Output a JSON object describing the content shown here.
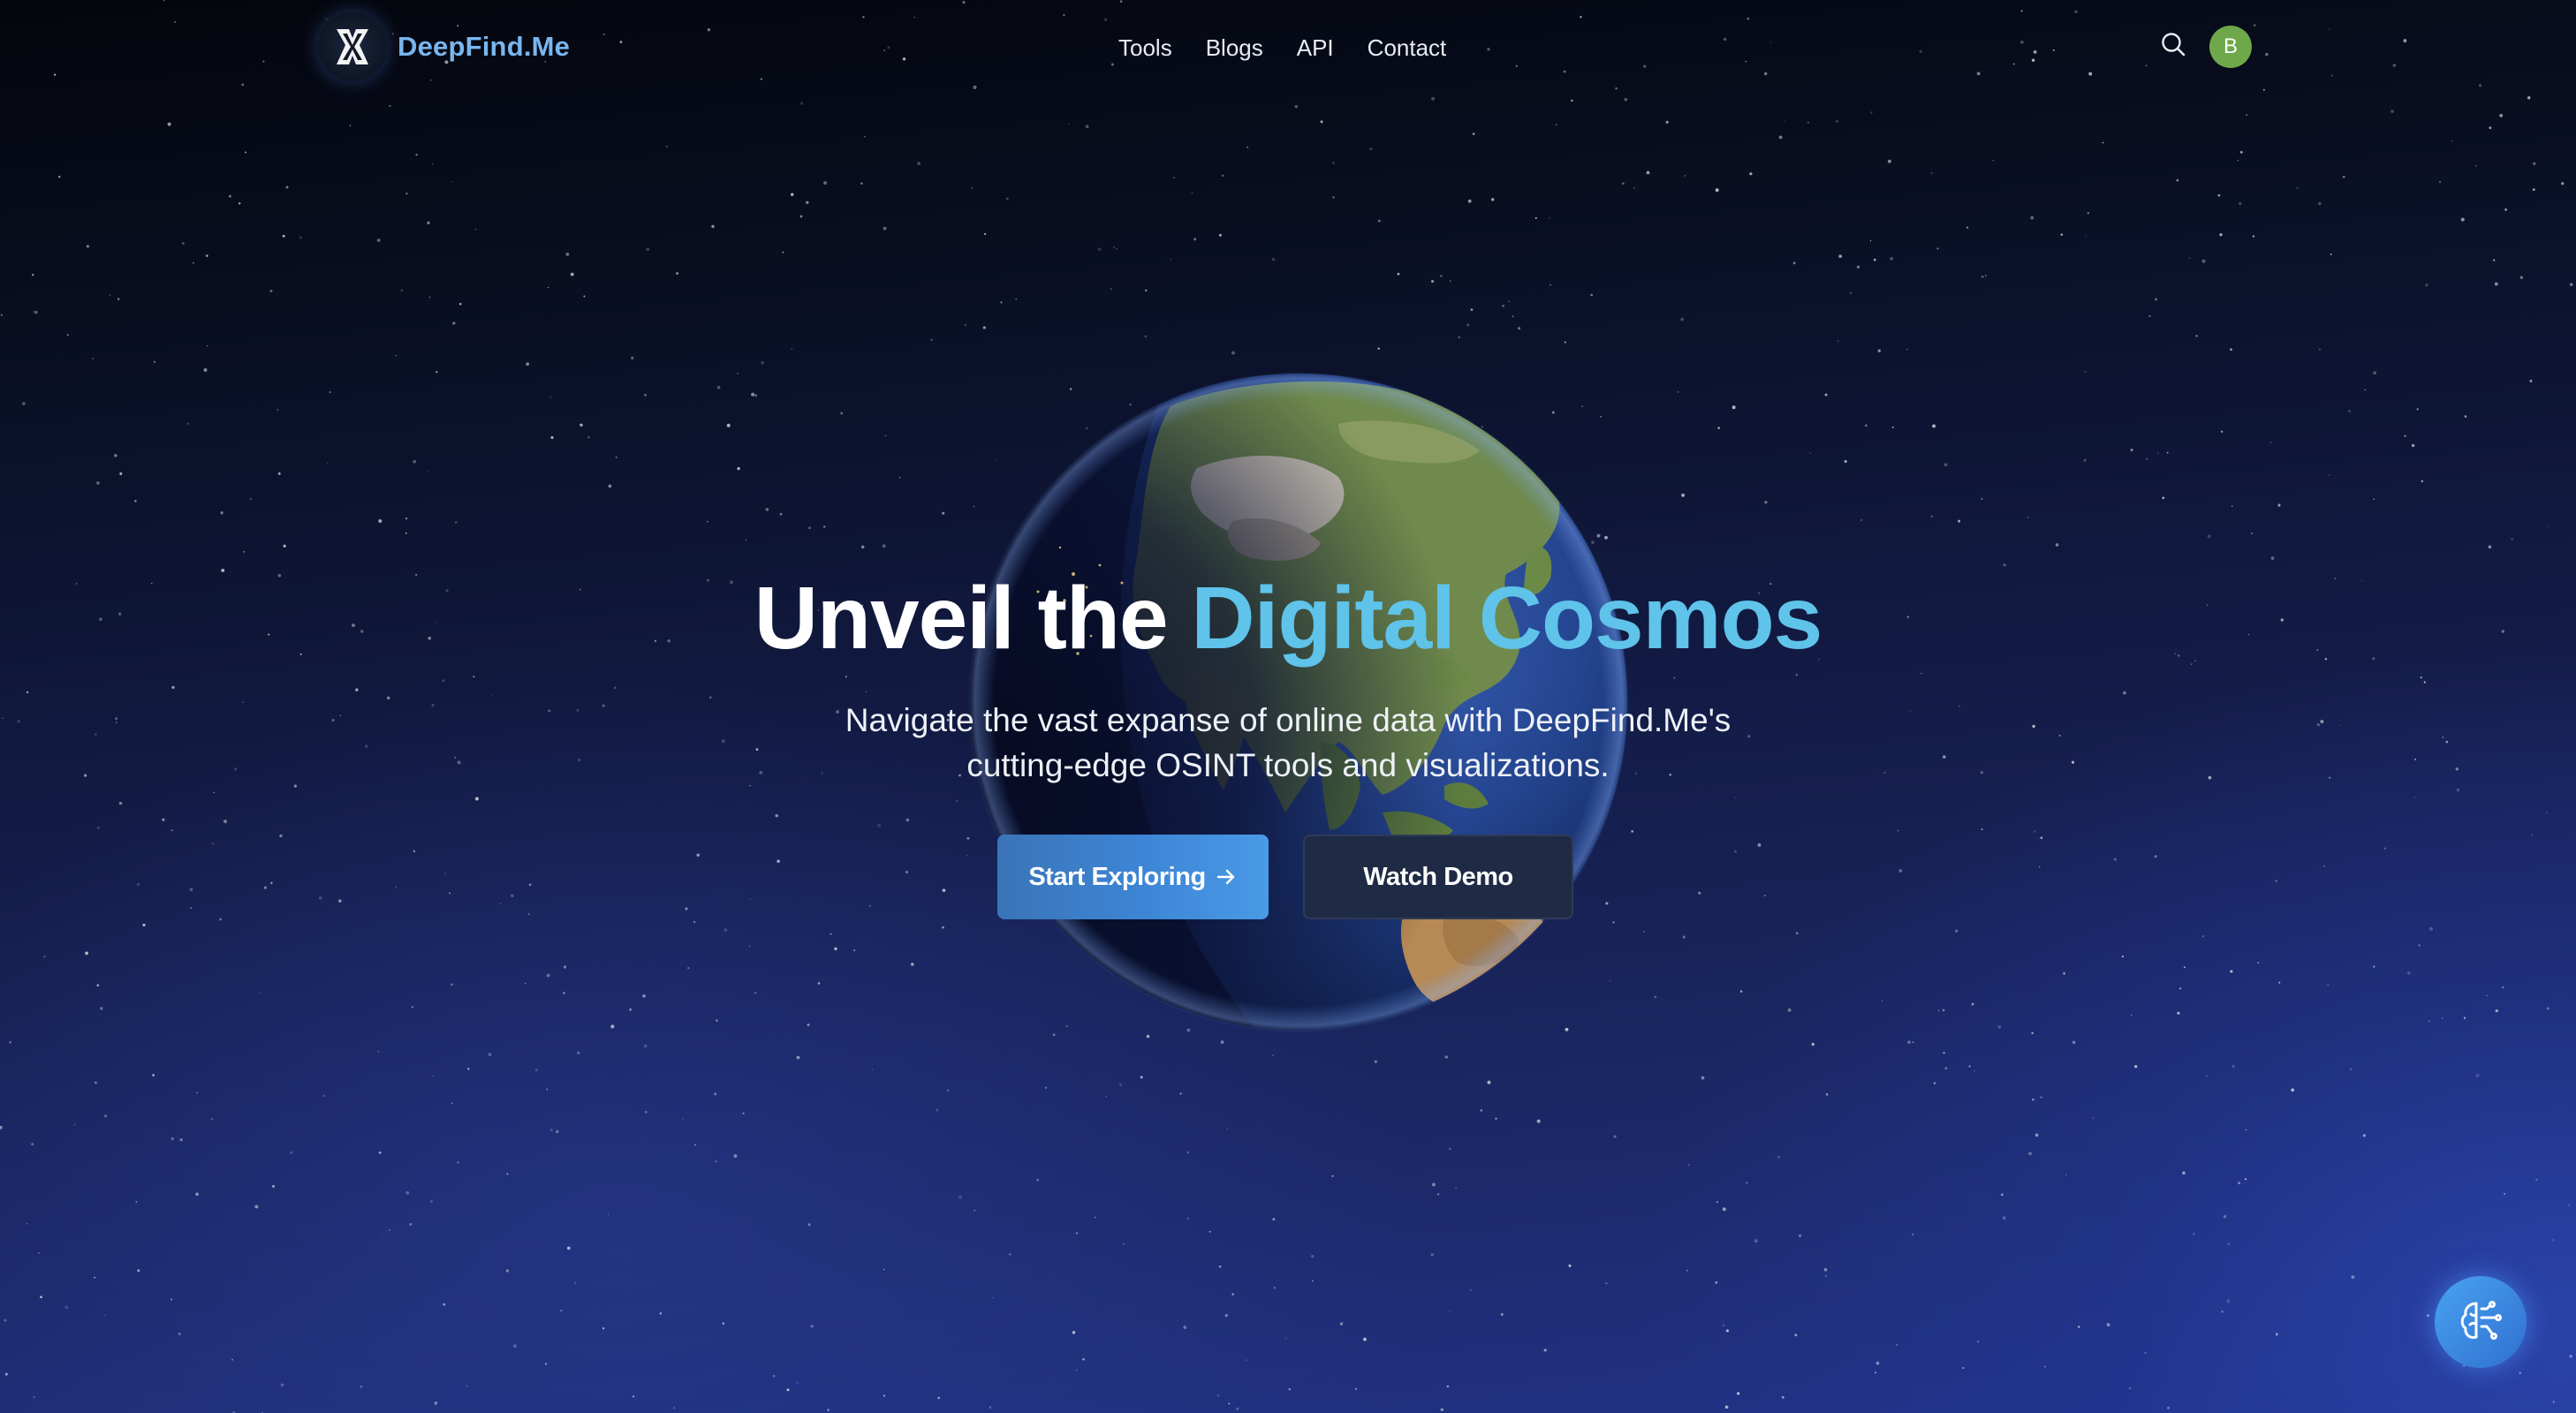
{
  "brand": {
    "name": "DeepFind.Me",
    "logo_icon": "deepfind-logo-icon",
    "color": "#79b6ee"
  },
  "nav": {
    "items": [
      {
        "label": "Tools"
      },
      {
        "label": "Blogs"
      },
      {
        "label": "API"
      },
      {
        "label": "Contact"
      }
    ]
  },
  "header": {
    "search_icon": "search-icon",
    "avatar_initial": "B",
    "avatar_color": "#6ea84a"
  },
  "hero": {
    "title_plain": "Unveil the ",
    "title_accent": "Digital Cosmos",
    "accent_color": "#5fc3ea",
    "subtitle_line1": "Navigate the vast expanse of online data with DeepFind.Me's",
    "subtitle_line2": "cutting-edge OSINT tools and visualizations.",
    "primary_button": "Start Exploring",
    "primary_icon": "arrow-right-icon",
    "secondary_button": "Watch Demo",
    "background_image": "earth-globe"
  },
  "assistant": {
    "icon": "ai-brain-icon"
  }
}
